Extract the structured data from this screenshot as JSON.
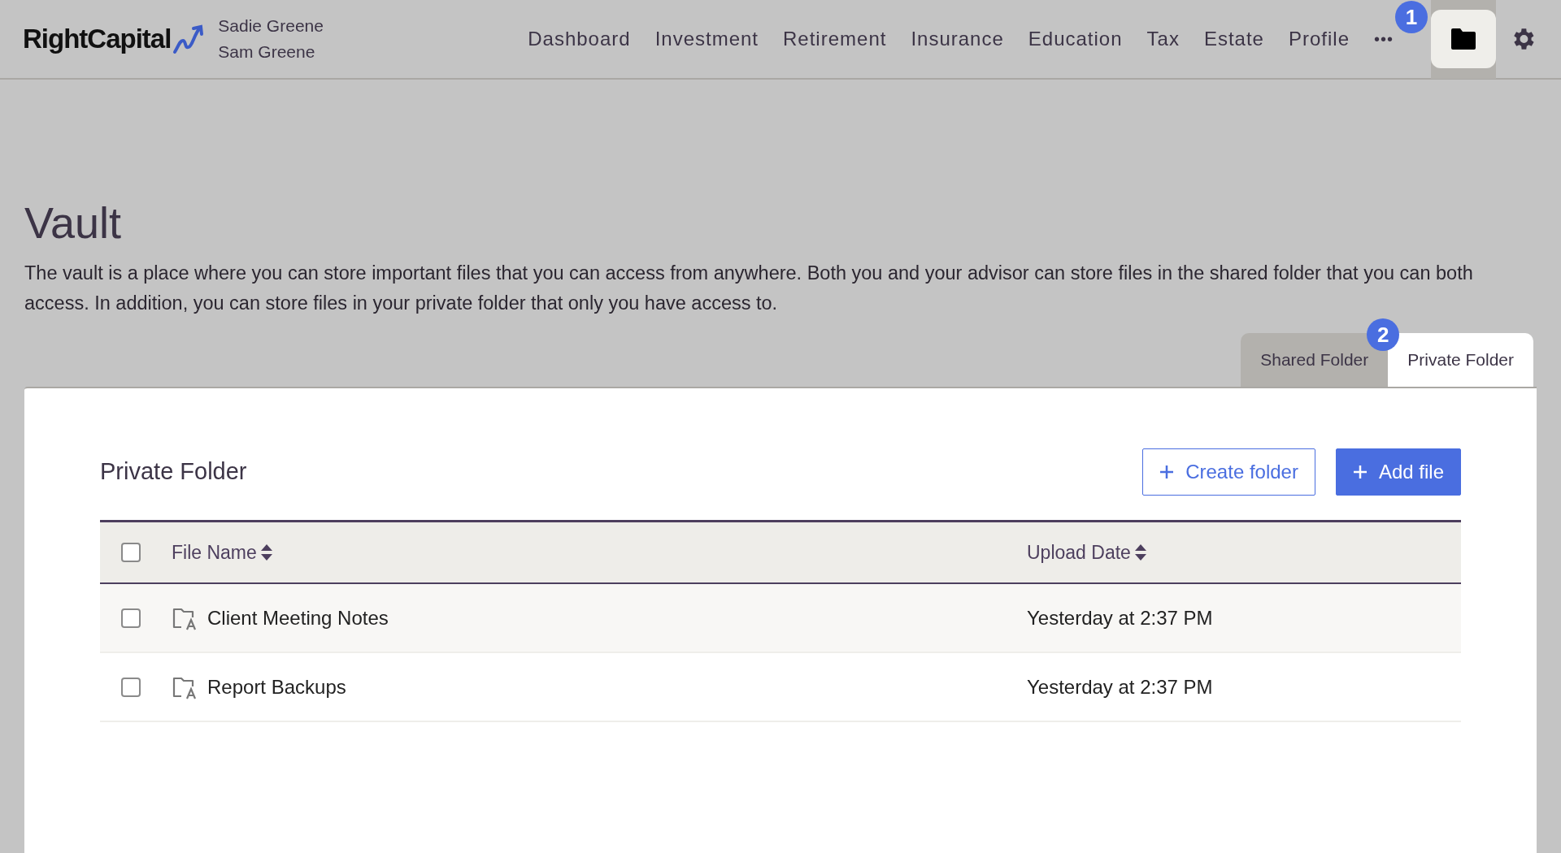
{
  "header": {
    "logo": "RightCapital",
    "clients": [
      "Sadie Greene",
      "Sam Greene"
    ],
    "nav": [
      {
        "label": "Dashboard"
      },
      {
        "label": "Investment"
      },
      {
        "label": "Retirement"
      },
      {
        "label": "Insurance"
      },
      {
        "label": "Education"
      },
      {
        "label": "Tax"
      },
      {
        "label": "Estate"
      },
      {
        "label": "Profile"
      }
    ],
    "more": "•••",
    "vault_button": {
      "selected": true,
      "callout": "1"
    }
  },
  "page": {
    "title": "Vault",
    "description": "The vault is a place where you can store important files that you can access from anywhere. Both you and your advisor can store files in the shared folder that you can both access. In addition, you can store files in your private folder that only you have access to."
  },
  "tabs": [
    {
      "label": "Shared Folder",
      "selected": false
    },
    {
      "label": "Private Folder",
      "selected": true,
      "callout": "2"
    }
  ],
  "panel": {
    "title": "Private Folder",
    "buttons": [
      {
        "label": "Create folder",
        "kind": "outline"
      },
      {
        "label": "Add file",
        "kind": "solid"
      }
    ],
    "table": {
      "columns": [
        "File Name",
        "Upload Date"
      ],
      "all_checked": false,
      "rows": [
        {
          "name": "Client Meeting Notes",
          "date": "Yesterday at 2:37 PM",
          "checked": false
        },
        {
          "name": "Report Backups",
          "date": "Yesterday at 2:37 PM",
          "checked": false
        }
      ]
    }
  }
}
